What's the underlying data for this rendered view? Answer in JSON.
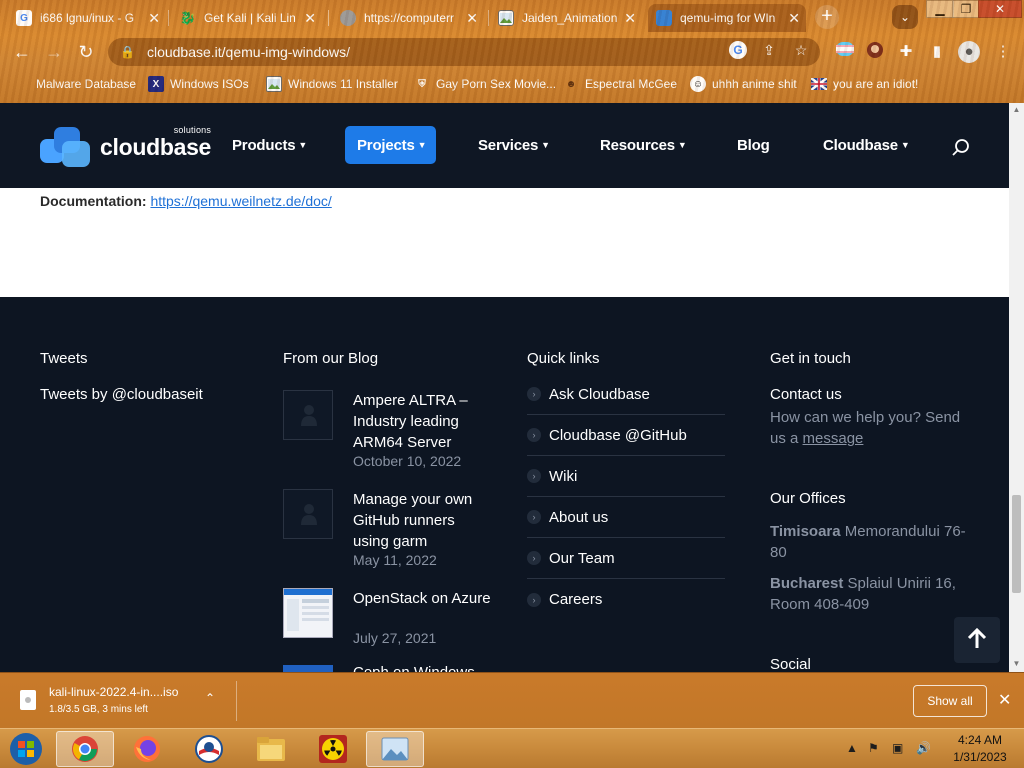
{
  "browser": {
    "tabs": [
      {
        "title": "i686 lgnu/inux - G",
        "favicon": "google-g-icon",
        "color": "#ffffff"
      },
      {
        "title": "Get Kali | Kali Lin",
        "favicon": "kali-dragon-icon",
        "color": "#2b2b2b"
      },
      {
        "title": "https://computerr",
        "favicon": "loading-globe-icon",
        "color": "#888888"
      },
      {
        "title": "Jaiden_Animation",
        "favicon": "image-file-icon",
        "color": "#ffffff"
      },
      {
        "title": "qemu-img for WIn",
        "favicon": "cloudbase-icon",
        "color": "#4aa3ff"
      }
    ],
    "new_tab": "+",
    "url": "cloudbase.it/qemu-img-windows/",
    "bookmarks": [
      {
        "label": "Malware Database"
      },
      {
        "label": "Windows ISOs"
      },
      {
        "label": "Windows 11 Installer"
      },
      {
        "label": "Gay Porn Sex Movie..."
      },
      {
        "label": "Espectral McGee"
      },
      {
        "label": "uhhh anime shit"
      },
      {
        "label": "you are an idiot!"
      }
    ]
  },
  "site": {
    "logo_text": "cloudbase",
    "logo_sub": "solutions",
    "nav": [
      "Products",
      "Projects",
      "Services",
      "Resources",
      "Blog",
      "Cloudbase"
    ],
    "nav_active": "Projects",
    "doc_label": "Documentation:",
    "doc_link": "https://qemu.weilnetz.de/doc/"
  },
  "footer": {
    "tweets": {
      "title": "Tweets",
      "text": "Tweets by @cloudbaseit"
    },
    "blog": {
      "title": "From our Blog",
      "posts": [
        {
          "title": "Ampere ALTRA – Industry leading ARM64 Server",
          "date": "October 10, 2022"
        },
        {
          "title": "Manage your own GitHub runners using garm",
          "date": "May 11, 2022"
        },
        {
          "title": "OpenStack on Azure",
          "date": "July 27, 2021"
        },
        {
          "title": "Ceph on Windows",
          "date": ""
        }
      ]
    },
    "quick_links": {
      "title": "Quick links",
      "items": [
        "Ask Cloudbase",
        "Cloudbase @GitHub",
        "Wiki",
        "About us",
        "Our Team",
        "Careers"
      ]
    },
    "contact": {
      "title": "Get in touch",
      "contact_label": "Contact us",
      "contact_text": "How can we help you? Send us a",
      "contact_link": "message",
      "offices_title": "Our Offices",
      "office1_city": "Timisoara",
      "office1_addr": "Memorandului 76-80",
      "office2_city": "Bucharest",
      "office2_addr": "Splaiul Unirii 16, Room 408-409",
      "social_title": "Social"
    }
  },
  "download": {
    "filename": "kali-linux-2022.4-in....iso",
    "status": "1.8/3.5 GB, 3 mins left",
    "show_all": "Show all"
  },
  "taskbar": {
    "time": "4:24 AM",
    "date": "1/31/2023"
  }
}
